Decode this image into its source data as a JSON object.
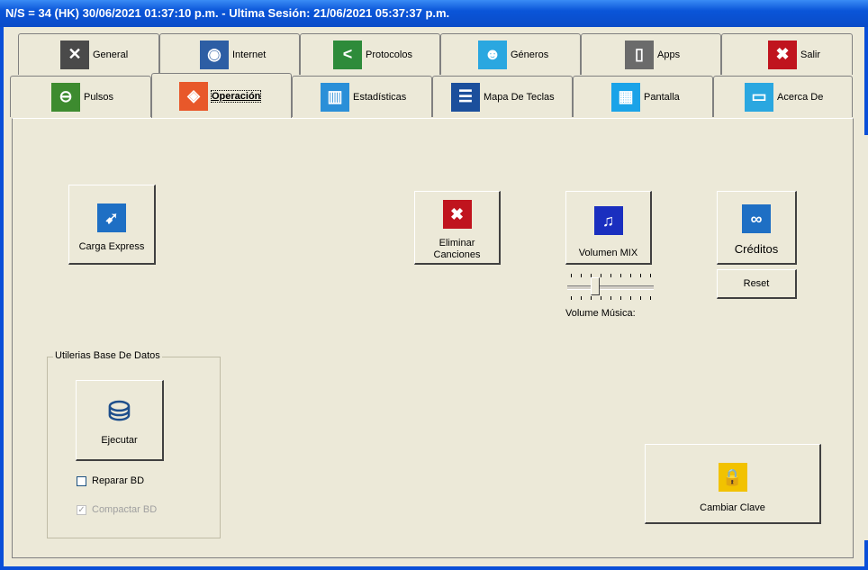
{
  "window": {
    "title": "N/S = 34 (HK) 30/06/2021 01:37:10 p.m. - Ultima Sesión: 21/06/2021 05:37:37 p.m."
  },
  "tabs_row1": [
    {
      "label": "General",
      "icon": "tools-icon",
      "color": "#4a4a4a"
    },
    {
      "label": "Internet",
      "icon": "globe-icon",
      "color": "#2d5ea4"
    },
    {
      "label": "Protocolos",
      "icon": "share-icon",
      "color": "#2e8b3a"
    },
    {
      "label": "Géneros",
      "icon": "users-icon",
      "color": "#2aa7e0"
    },
    {
      "label": "Apps",
      "icon": "phone-icon",
      "color": "#6b6b6b"
    },
    {
      "label": "Salir",
      "icon": "exit-icon",
      "color": "#c0141e"
    }
  ],
  "tabs_row2": [
    {
      "label": "Pulsos",
      "icon": "pulse-icon",
      "color": "#3d8b2f"
    },
    {
      "label": "Operación",
      "icon": "operation-icon",
      "color": "#e8582a"
    },
    {
      "label": "Estadísticas",
      "icon": "chart-icon",
      "color": "#2a8fd8"
    },
    {
      "label": "Mapa De Teclas",
      "icon": "keymap-icon",
      "color": "#1b4f9c"
    },
    {
      "label": "Pantalla",
      "icon": "grid-icon",
      "color": "#1aa3e8"
    },
    {
      "label": "Acerca De",
      "icon": "about-icon",
      "color": "#2aa7e0"
    }
  ],
  "buttons": {
    "carga_express": "Carga Express",
    "eliminar_canciones_1": "Eliminar",
    "eliminar_canciones_2": "Canciones",
    "volumen_mix": "Volumen MIX",
    "creditos": "Créditos",
    "reset": "Reset",
    "ejecutar": "Ejecutar",
    "cambiar_clave": "Cambiar Clave"
  },
  "slider": {
    "label": "Volume Música:",
    "value_fraction": 0.3
  },
  "database_group": {
    "title": "Utilerias Base De Datos",
    "reparar": {
      "label": "Reparar BD",
      "checked": false
    },
    "compactar": {
      "label": "Compactar BD",
      "checked": true,
      "disabled": true
    }
  },
  "colors": {
    "title_bar": "#0a55d8",
    "face": "#ece9d8"
  }
}
